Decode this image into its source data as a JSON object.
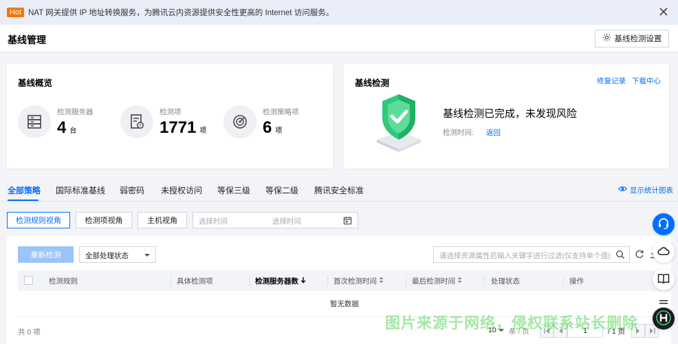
{
  "notice": {
    "badge": "Hot",
    "text": "NAT 网关提供 IP 地址转换服务，为腾讯云内资源提供安全性更高的 Internet 访问服务。"
  },
  "header": {
    "title": "基线管理",
    "settings_button": "基线检测设置"
  },
  "overview": {
    "title": "基线概览",
    "stats": [
      {
        "label": "检测服务器",
        "value": "4",
        "unit": "台",
        "icon": "server-icon"
      },
      {
        "label": "检测项",
        "value": "1771",
        "unit": "项",
        "icon": "checklist-icon"
      },
      {
        "label": "检测策略项",
        "value": "6",
        "unit": "项",
        "icon": "radar-icon"
      }
    ]
  },
  "detection": {
    "title": "基线检测",
    "repair_log": "修复记录",
    "download_center": "下载中心",
    "result": "基线检测已完成，未发现风险",
    "time_label": "检测时间:",
    "return_link": "返回"
  },
  "tabs": [
    {
      "label": "全部策略",
      "active": true
    },
    {
      "label": "国际标准基线"
    },
    {
      "label": "弱密码"
    },
    {
      "label": "未授权访问"
    },
    {
      "label": "等保三级"
    },
    {
      "label": "等保二级"
    },
    {
      "label": "腾讯安全标准"
    }
  ],
  "show_chart": "显示统计图表",
  "views": [
    {
      "label": "检测规则视角",
      "active": true
    },
    {
      "label": "检测项视角"
    },
    {
      "label": "主机视角"
    }
  ],
  "date_range": {
    "start_placeholder": "选择时间",
    "end_placeholder": "选择时间"
  },
  "table": {
    "recheck_button": "重新检测",
    "status_filter": "全部处理状态",
    "search_placeholder": "请选择资源属性后输入关键字进行过滤(仅支持单个值)",
    "columns": [
      "检测规则",
      "具体检测项",
      "检测服务器数",
      "首次检测时间",
      "最后检测时间",
      "处理状态",
      "操作"
    ],
    "empty_text": "暂无数据"
  },
  "pagination": {
    "total": "共 0 项",
    "page_size": "10",
    "per_page": "条 / 页",
    "current_page": "1",
    "total_pages": "/ 1 页"
  },
  "watermark": "图片来源于网络，侵权联系站长删除",
  "colors": {
    "primary": "#006eff",
    "hot": "#ff7200",
    "shield": "#2fc97a"
  }
}
